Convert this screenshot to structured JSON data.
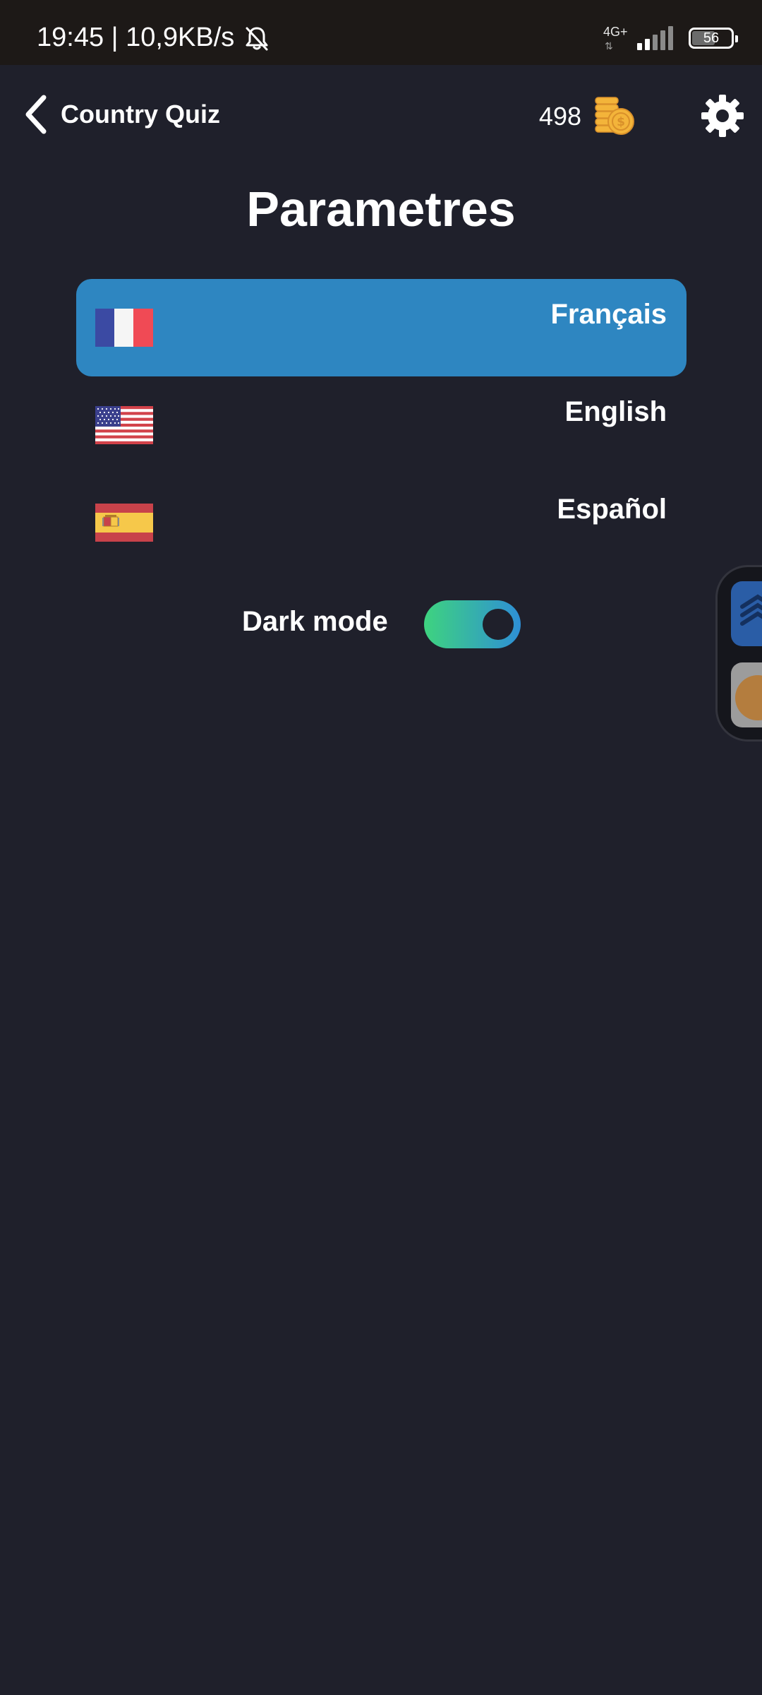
{
  "status_bar": {
    "time_and_speed": "19:45 | 10,9KB/s",
    "network_type": "4G+",
    "battery_level": "56",
    "signal_bars_on": 2,
    "signal_bars_total": 5
  },
  "header": {
    "app_title": "Country Quiz",
    "coin_count": "498"
  },
  "page": {
    "title": "Parametres"
  },
  "languages": [
    {
      "label": "Français",
      "flag": "flag-france-icon",
      "selected": true
    },
    {
      "label": "English",
      "flag": "flag-usa-icon",
      "selected": false
    },
    {
      "label": "Español",
      "flag": "flag-spain-icon",
      "selected": false
    }
  ],
  "settings": {
    "dark_mode_label": "Dark mode",
    "dark_mode_on": true
  },
  "colors": {
    "background": "#1f202b",
    "status_bar": "#1d1917",
    "selected_item": "#2e86c1",
    "toggle_gradient_start": "#3ed37f",
    "toggle_gradient_end": "#2e8fd6",
    "coin": "#f3b43a"
  }
}
